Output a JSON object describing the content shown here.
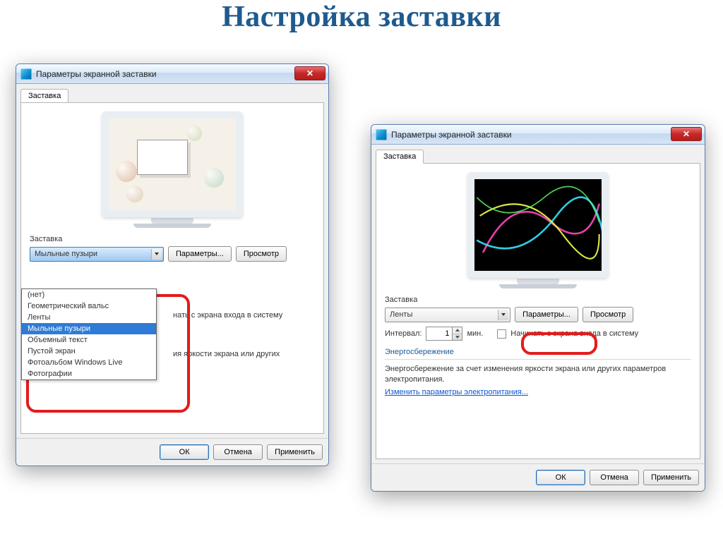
{
  "slide_title": "Настройка заставки",
  "dialog": {
    "title": "Параметры экранной заставки",
    "tab": "Заставка",
    "close_glyph": "✕",
    "section_label": "Заставка",
    "params_btn": "Параметры...",
    "preview_btn": "Просмотр",
    "interval_label": "Интервал:",
    "interval_value": "1",
    "interval_unit": "мин.",
    "checkbox_label": "Начинать с экрана входа в систему",
    "energy_title": "Энергосбережение",
    "energy_desc": "Энергосбережение за счет изменения яркости экрана или других параметров электропитания.",
    "energy_link": "Изменить параметры электропитания...",
    "ok": "ОК",
    "cancel": "Отмена",
    "apply": "Применить",
    "start_suffix": "нать с экрана входа в систему",
    "brightness_suffix": "ия яркости экрана или других"
  },
  "left": {
    "combo_selected": "Мыльные пузыри",
    "options": [
      "(нет)",
      "Геометрический вальс",
      "Ленты",
      "Мыльные пузыри",
      "Объемный текст",
      "Пустой экран",
      "Фотоальбом Windows Live",
      "Фотографии"
    ],
    "selected_index": 3
  },
  "right": {
    "combo_selected": "Ленты"
  }
}
